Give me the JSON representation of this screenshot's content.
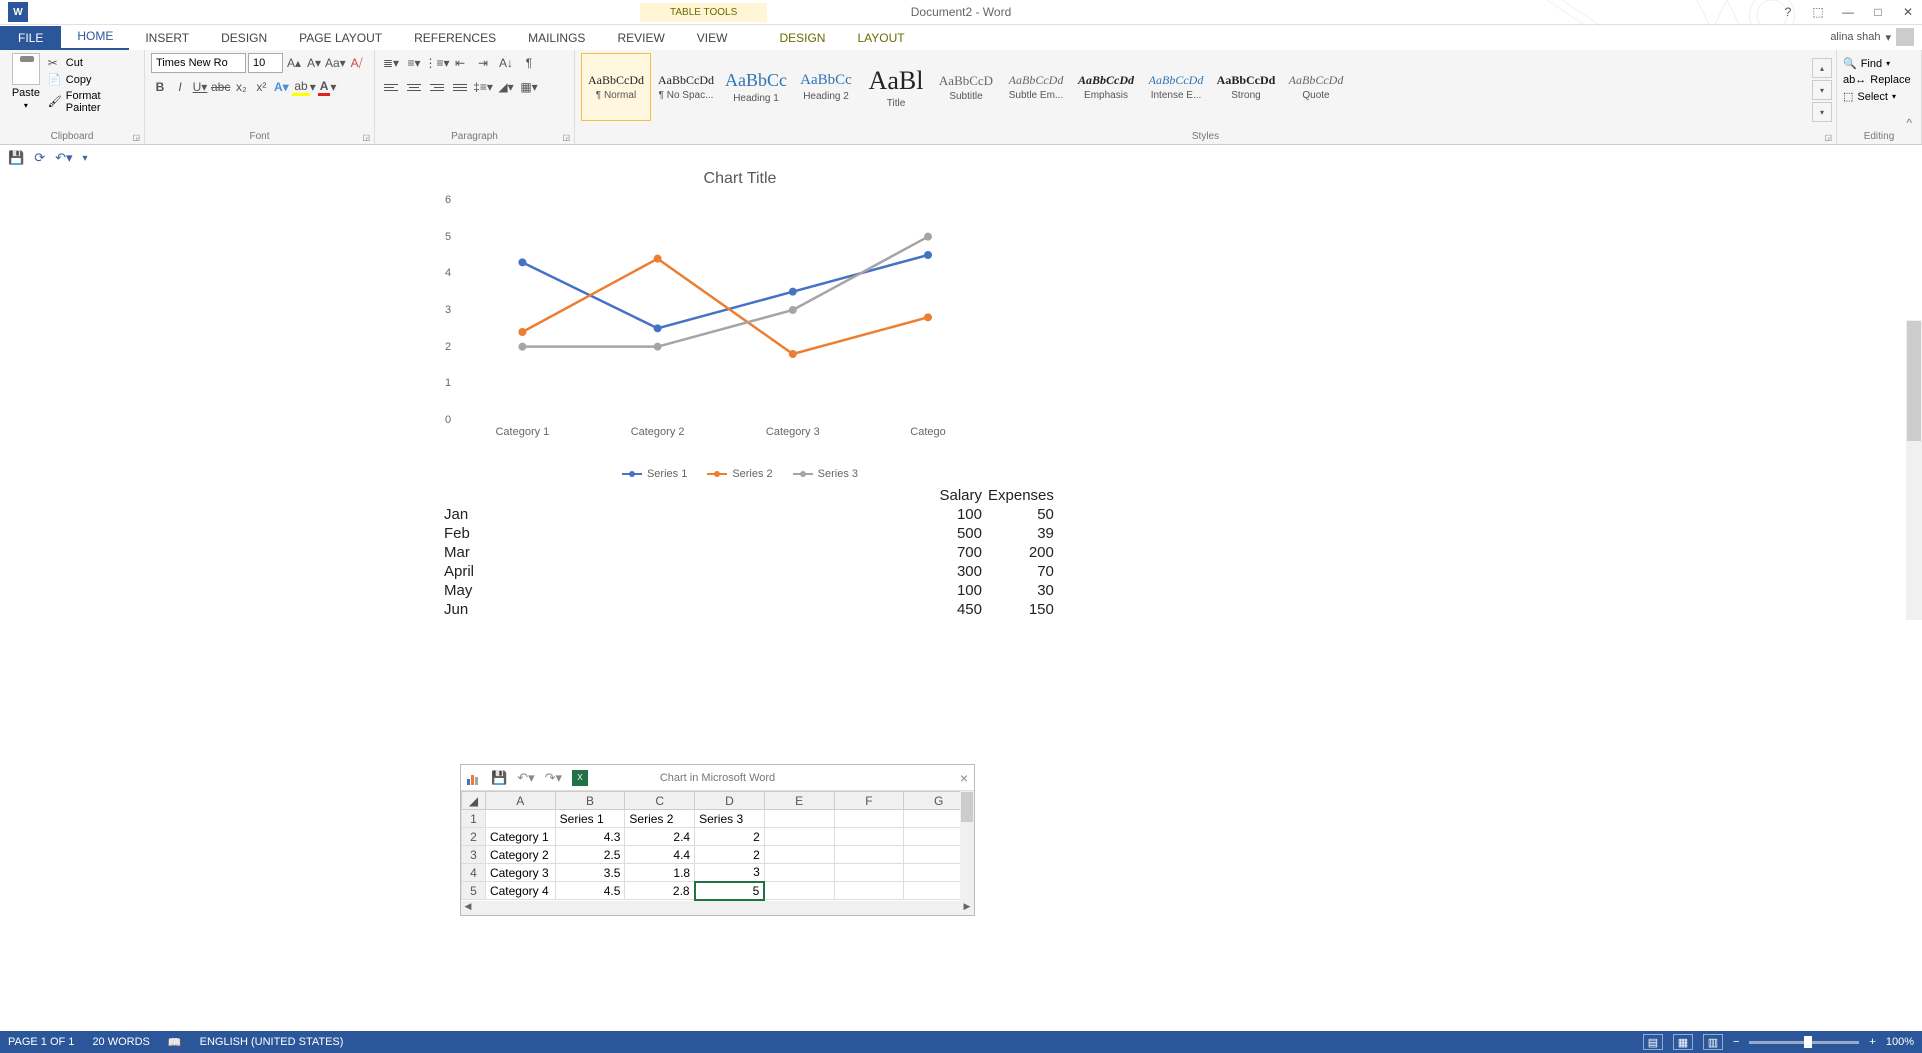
{
  "title": "Document2 - Word",
  "contextual_tab_group": "TABLE TOOLS",
  "user": "alina shah",
  "tabs": {
    "file": "FILE",
    "home": "HOME",
    "insert": "INSERT",
    "design": "DESIGN",
    "page_layout": "PAGE LAYOUT",
    "references": "REFERENCES",
    "mailings": "MAILINGS",
    "review": "REVIEW",
    "view": "VIEW",
    "ctx_design": "DESIGN",
    "ctx_layout": "LAYOUT"
  },
  "clipboard": {
    "paste": "Paste",
    "cut": "Cut",
    "copy": "Copy",
    "format_painter": "Format Painter",
    "label": "Clipboard"
  },
  "font": {
    "name": "Times New Ro",
    "size": "10",
    "label": "Font"
  },
  "paragraph": {
    "label": "Paragraph"
  },
  "styles": {
    "label": "Styles",
    "items": [
      {
        "preview": "AaBbCcDd",
        "name": "¶ Normal",
        "size": "12px",
        "color": "#222",
        "sel": true
      },
      {
        "preview": "AaBbCcDd",
        "name": "¶ No Spac...",
        "size": "12px",
        "color": "#222"
      },
      {
        "preview": "AaBbCc",
        "name": "Heading 1",
        "size": "18px",
        "color": "#2e74b5"
      },
      {
        "preview": "AaBbCc",
        "name": "Heading 2",
        "size": "15px",
        "color": "#2e74b5"
      },
      {
        "preview": "AaBl",
        "name": "Title",
        "size": "26px",
        "color": "#222"
      },
      {
        "preview": "AaBbCcD",
        "name": "Subtitle",
        "size": "13px",
        "color": "#666"
      },
      {
        "preview": "AaBbCcDd",
        "name": "Subtle Em...",
        "size": "12px",
        "color": "#666",
        "italic": true
      },
      {
        "preview": "AaBbCcDd",
        "name": "Emphasis",
        "size": "12px",
        "color": "#222",
        "italic": true,
        "bold": true
      },
      {
        "preview": "AaBbCcDd",
        "name": "Intense E...",
        "size": "12px",
        "color": "#2e74b5",
        "italic": true
      },
      {
        "preview": "AaBbCcDd",
        "name": "Strong",
        "size": "12px",
        "color": "#222",
        "bold": true
      },
      {
        "preview": "AaBbCcDd",
        "name": "Quote",
        "size": "12px",
        "color": "#666",
        "italic": true
      }
    ]
  },
  "editing": {
    "find": "Find",
    "replace": "Replace",
    "select": "Select",
    "label": "Editing"
  },
  "chart_data": {
    "type": "line",
    "title": "Chart Title",
    "categories": [
      "Category 1",
      "Category 2",
      "Category 3",
      "Category 4"
    ],
    "x_ticks_visible": [
      "Category 1",
      "Category 2",
      "Category 3",
      "Catego"
    ],
    "series": [
      {
        "name": "Series 1",
        "values": [
          4.3,
          2.5,
          3.5,
          4.5
        ],
        "color": "#4472c4"
      },
      {
        "name": "Series 2",
        "values": [
          2.4,
          4.4,
          1.8,
          2.8
        ],
        "color": "#ed7d31"
      },
      {
        "name": "Series 3",
        "values": [
          2,
          2,
          3,
          5
        ],
        "color": "#a5a5a5"
      }
    ],
    "ylim": [
      0,
      6
    ],
    "y_ticks": [
      0,
      1,
      2,
      3,
      4,
      5,
      6
    ],
    "xlabel": "",
    "ylabel": ""
  },
  "doc_table": {
    "headers": [
      "",
      "Salary",
      "Expenses"
    ],
    "rows": [
      {
        "month": "Jan",
        "salary": "100",
        "expenses": "50"
      },
      {
        "month": "Feb",
        "salary": "500",
        "expenses": "39"
      },
      {
        "month": "Mar",
        "salary": "700",
        "expenses": "200"
      },
      {
        "month": "April",
        "salary": "300",
        "expenses": "70"
      },
      {
        "month": "May",
        "salary": "100",
        "expenses": "30"
      },
      {
        "month": "Jun",
        "salary": "450",
        "expenses": "150"
      }
    ]
  },
  "excel": {
    "title": "Chart in Microsoft Word",
    "cols": [
      "A",
      "B",
      "C",
      "D",
      "E",
      "F",
      "G"
    ],
    "headers": [
      "",
      "Series 1",
      "Series 2",
      "Series 3"
    ],
    "rows": [
      {
        "n": "1"
      },
      {
        "n": "2",
        "a": "Category 1",
        "b": "4.3",
        "c": "2.4",
        "d": "2"
      },
      {
        "n": "3",
        "a": "Category 2",
        "b": "2.5",
        "c": "4.4",
        "d": "2"
      },
      {
        "n": "4",
        "a": "Category 3",
        "b": "3.5",
        "c": "1.8",
        "d": "3"
      },
      {
        "n": "5",
        "a": "Category 4",
        "b": "4.5",
        "c": "2.8",
        "d": "5"
      }
    ],
    "active_cell": "D5"
  },
  "status": {
    "page": "PAGE 1 OF 1",
    "words": "20 WORDS",
    "lang": "ENGLISH (UNITED STATES)",
    "zoom": "100%"
  }
}
